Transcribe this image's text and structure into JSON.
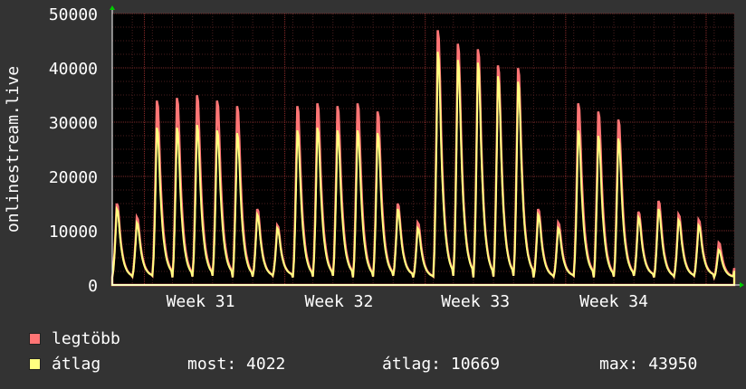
{
  "chart_data": {
    "type": "area",
    "ylabel": "onlinestream.live",
    "ylim": [
      0,
      50000
    ],
    "y_ticks": [
      0,
      10000,
      20000,
      30000,
      40000,
      50000
    ],
    "x_tick_labels": [
      "Week 31",
      "Week 32",
      "Week 33",
      "Week 34"
    ],
    "grid": true,
    "legend_placement": "bottom-left",
    "days": 31,
    "daily_peaks": {
      "max": [
        15000,
        12500,
        34000,
        34500,
        35000,
        34000,
        33000,
        14000,
        11000,
        33000,
        33500,
        33000,
        33500,
        32000,
        15000,
        11500,
        47000,
        44500,
        43500,
        40500,
        40000,
        14000,
        11500,
        33500,
        32000,
        30500,
        13500,
        15500,
        13000,
        12000,
        7800
      ],
      "avg": [
        14000,
        11500,
        29000,
        29000,
        29500,
        28500,
        28000,
        13000,
        10500,
        28500,
        29000,
        28500,
        28500,
        28000,
        14000,
        10500,
        43000,
        41500,
        41000,
        38500,
        37500,
        13000,
        10500,
        28500,
        27500,
        27000,
        12500,
        14000,
        12000,
        11000,
        6500
      ]
    },
    "series": [
      {
        "name": "legtöbb",
        "color": "#ff7575"
      },
      {
        "name": "átlag",
        "color": "#ffff80"
      }
    ]
  },
  "stats": {
    "most_label": "most:",
    "most_value": "4022",
    "atlag_label": "átlag:",
    "atlag_value": "10669",
    "max_label": "max:",
    "max_value": "43950"
  }
}
